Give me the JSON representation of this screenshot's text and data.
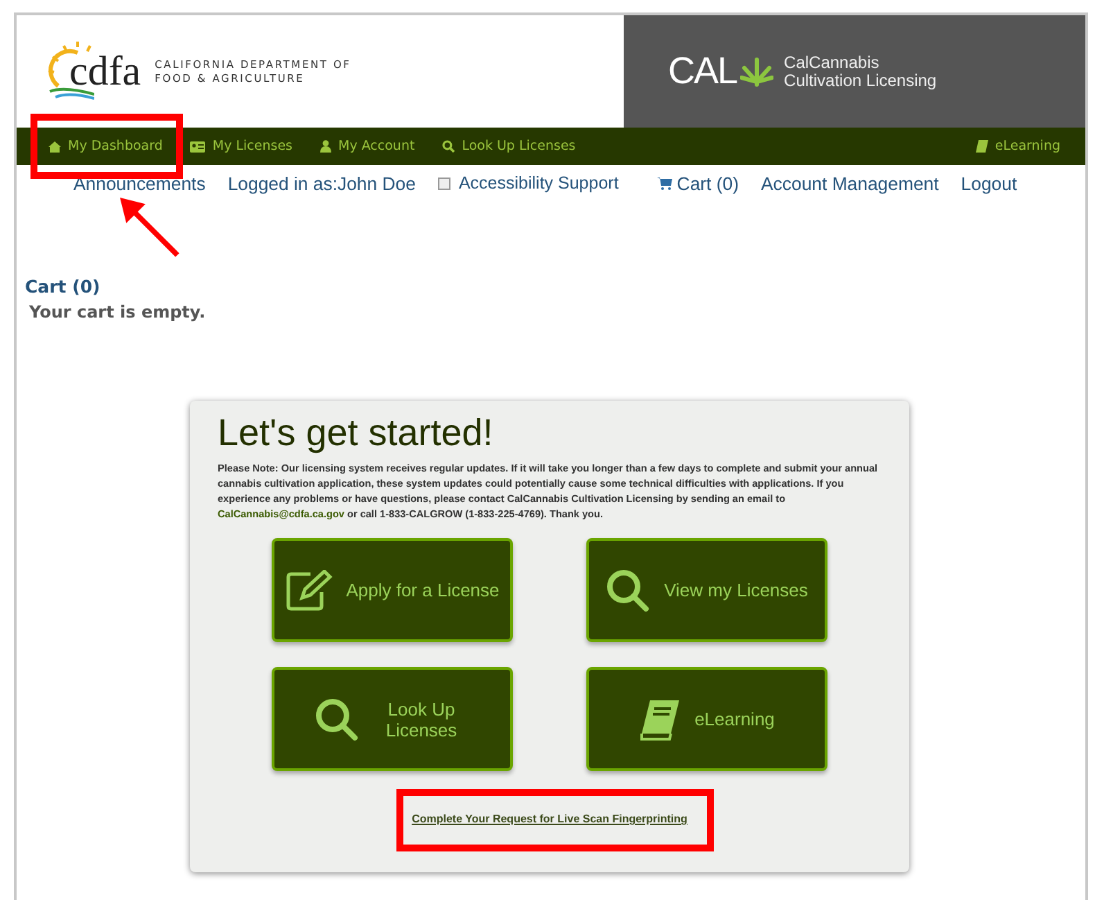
{
  "header": {
    "agency_line_1": "CALIFORNIA DEPARTMENT OF",
    "agency_line_2": "FOOD & AGRICULTURE",
    "logo_text": "cdfa",
    "brand_mark": "CAL",
    "brand_line_1": "CalCannabis",
    "brand_line_2": "Cultivation Licensing"
  },
  "nav": {
    "items": [
      {
        "label": "My Dashboard",
        "kind": "home"
      },
      {
        "label": "My Licenses",
        "kind": "card"
      },
      {
        "label": "My Account",
        "kind": "user"
      },
      {
        "label": "Look Up Licenses",
        "kind": "search"
      }
    ],
    "right_item": {
      "label": "eLearning",
      "kind": "book"
    }
  },
  "links": [
    {
      "label": "Announcements",
      "kind": "link"
    },
    {
      "label": "Logged in as:John Doe",
      "kind": "text"
    },
    {
      "label": "Accessibility Support",
      "kind": "checkbox",
      "checked": false
    },
    {
      "label": "Cart (0)",
      "kind": "cart"
    },
    {
      "label": "Account Management",
      "kind": "link"
    },
    {
      "label": "Logout",
      "kind": "link"
    }
  ],
  "cart": {
    "title": "Cart (0)",
    "message": "Your cart is empty."
  },
  "card": {
    "title": "Let's get started!",
    "note_before": "Please Note: Our licensing system receives regular updates. If it will take you longer than a few days to complete and submit your annual cannabis cultivation application, these system updates could potentially cause some technical difficulties with applications. If you experience any problems or have questions, please contact CalCannabis Cultivation Licensing by sending an email to",
    "email": "CalCannabis@cdfa.ca.gov",
    "note_after": "or call 1-833-CALGROW (1-833-225-4769). Thank you.",
    "tiles": [
      {
        "label": "Apply for a License",
        "kind": "edit"
      },
      {
        "label": "View my Licenses",
        "kind": "search"
      },
      {
        "label": "Look Up Licenses",
        "kind": "search"
      },
      {
        "label": "eLearning",
        "kind": "book"
      }
    ],
    "fingerprint_link": "Complete Your Request for Live Scan Fingerprinting"
  }
}
